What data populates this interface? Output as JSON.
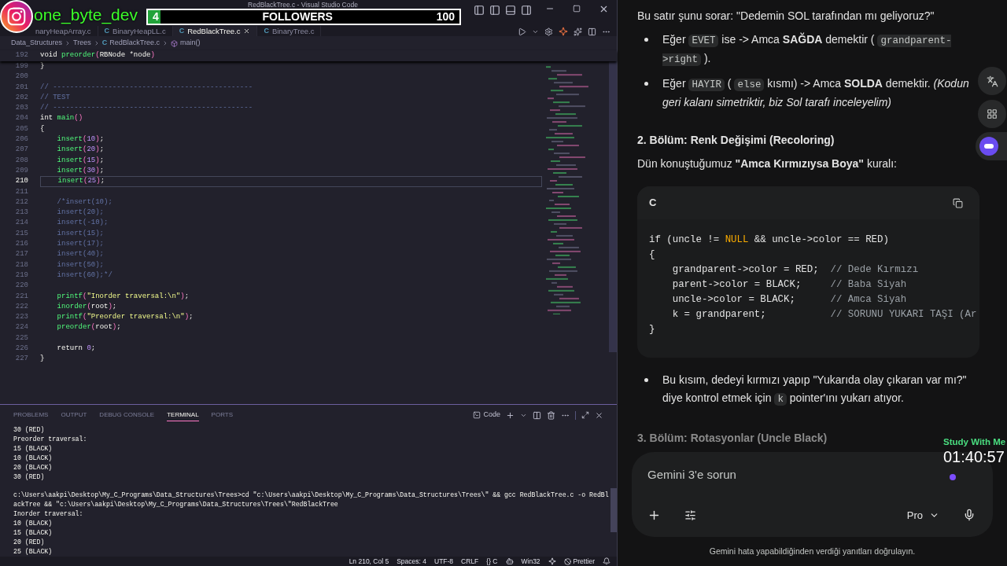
{
  "overlay": {
    "handle": "one_byte_dev",
    "followers": {
      "count": "4",
      "label": "FOLLOWERS",
      "goal": "100",
      "level": 0.04
    },
    "study_label": "Study With Me",
    "timer": "01:40:57"
  },
  "window": {
    "title": "RedBlackTree.c - Visual Studio Code"
  },
  "tabs": [
    {
      "label": "naryHeapArray.c",
      "selected": false
    },
    {
      "label": "BinaryHeapLL.c",
      "icon": "C",
      "selected": false
    },
    {
      "label": "RedBlackTree.c",
      "icon": "C",
      "selected": true
    },
    {
      "label": "BinaryTree.c",
      "icon": "C",
      "selected": false
    }
  ],
  "breadcrumb": [
    {
      "label": "Data_Structures"
    },
    {
      "label": "Trees"
    },
    {
      "label": "RedBlackTree.c",
      "icon": "C"
    },
    {
      "label": "main()"
    }
  ],
  "editor": {
    "sticky": {
      "num": "192",
      "text": "void preorder(RBNode *node)"
    },
    "lines": [
      {
        "num": "199",
        "current": false,
        "text": "}"
      },
      {
        "num": "200",
        "current": false
      },
      {
        "num": "201",
        "current": false,
        "text": "// -----------------------------------------------"
      },
      {
        "num": "202",
        "current": false,
        "text": "// TEST"
      },
      {
        "num": "203",
        "current": false,
        "text": "// -----------------------------------------------"
      },
      {
        "num": "204",
        "current": false,
        "text": "int main()"
      },
      {
        "num": "205",
        "current": false,
        "text": "{"
      },
      {
        "num": "206",
        "current": false,
        "text": "    insert(10);"
      },
      {
        "num": "207",
        "current": false,
        "text": "    insert(20);"
      },
      {
        "num": "208",
        "current": false,
        "text": "    insert(15);"
      },
      {
        "num": "209",
        "current": false,
        "text": "    insert(30);"
      },
      {
        "num": "210",
        "current": true,
        "text": "    insert(25);"
      },
      {
        "num": "211",
        "current": false
      },
      {
        "num": "212",
        "current": false,
        "text": "    /*insert(10);"
      },
      {
        "num": "213",
        "current": false,
        "text": "    insert(20);"
      },
      {
        "num": "214",
        "current": false,
        "text": "    insert(-10);"
      },
      {
        "num": "215",
        "current": false,
        "text": "    insert(15);"
      },
      {
        "num": "216",
        "current": false,
        "text": "    insert(17);"
      },
      {
        "num": "217",
        "current": false,
        "text": "    insert(40);"
      },
      {
        "num": "218",
        "current": false,
        "text": "    insert(50);"
      },
      {
        "num": "219",
        "current": false,
        "text": "    insert(60);*/"
      },
      {
        "num": "220",
        "current": false
      },
      {
        "num": "221",
        "current": false,
        "text": "    printf(\"Inorder traversal:\\n\");"
      },
      {
        "num": "222",
        "current": false,
        "text": "    inorder(root);"
      },
      {
        "num": "223",
        "current": false,
        "text": "    printf(\"Preorder traversal:\\n\");"
      },
      {
        "num": "224",
        "current": false,
        "text": "    preorder(root);"
      },
      {
        "num": "225",
        "current": false
      },
      {
        "num": "226",
        "current": false,
        "text": "    return 0;"
      },
      {
        "num": "227",
        "current": false,
        "text": "}"
      }
    ]
  },
  "panel": {
    "tabs": [
      {
        "label": "PROBLEMS",
        "selected": false
      },
      {
        "label": "OUTPUT",
        "selected": false
      },
      {
        "label": "DEBUG CONSOLE",
        "selected": false
      },
      {
        "label": "TERMINAL",
        "selected": true
      },
      {
        "label": "PORTS",
        "selected": false
      }
    ],
    "profile": "Code",
    "output": [
      {
        "lines": [
          "30 (RED)",
          "Preorder traversal:",
          "15 (BLACK)",
          "10 (BLACK)",
          "20 (BLACK)",
          "30 (RED)"
        ]
      },
      {
        "lines": [
          "c:\\Users\\aakpi\\Desktop\\My_C_Programs\\Data_Structures\\Trees>cd \"c:\\Users\\aakpi\\Desktop\\My_C_Programs\\Data_Structures\\Trees\\\" && gcc RedBlackTree.c -o RedBl",
          "ackTree && \"c:\\Users\\aakpi\\Desktop\\My_C_Programs\\Data_Structures\\Trees\\\"RedBlackTree",
          "Inorder traversal:",
          "10 (BLACK)",
          "15 (BLACK)",
          "20 (RED)",
          "25 (BLACK)"
        ]
      }
    ]
  },
  "status_bar": [
    "Ln 210, Col 5",
    "Spaces: 4",
    "UTF-8",
    "CRLF",
    "{} C",
    "Win32",
    "Prettier"
  ],
  "chat": {
    "blocks": [
      {
        "kind": "paragraph",
        "parts": [
          {
            "kind": "text",
            "text": "Bu satır şunu sorar: \"Dedemin SOL tarafından mı geliyoruz?\""
          }
        ]
      },
      {
        "kind": "bullet",
        "parts": [
          {
            "kind": "text",
            "text": "Eğer "
          },
          {
            "kind": "code",
            "text": "EVET"
          },
          {
            "kind": "text",
            "text": " ise -> Amca **SAĞDA** demektir ( "
          },
          {
            "kind": "code",
            "text": "grandparent->right"
          },
          {
            "kind": "text",
            "text": " )."
          }
        ]
      },
      {
        "kind": "bullet",
        "parts": [
          {
            "kind": "text",
            "text": "Eğer "
          },
          {
            "kind": "code",
            "text": "HAYIR"
          },
          {
            "kind": "text",
            "text": " ( "
          },
          {
            "kind": "code",
            "text": "else"
          },
          {
            "kind": "text",
            "text": " kısmı) -> Amca **SOLDA** demektir. *(Kodun geri kalanı simetriktir, biz Sol tarafı inceleyelim)*"
          }
        ]
      },
      {
        "kind": "heading",
        "faded": false,
        "parts": [
          {
            "kind": "text",
            "text": "2. Bölüm: Renk Değişimi (Recoloring)"
          }
        ]
      },
      {
        "kind": "paragraph",
        "parts": [
          {
            "kind": "text",
            "text": "Dün konuştuğumuz **\"Amca Kırmızıysa Boya\"** kuralı:"
          }
        ]
      },
      {
        "kind": "code",
        "language": "C",
        "lines": [
          "if (uncle != NULL && uncle->color == RED)",
          "{",
          "    grandparent->color = RED;  // Dede Kırmızı",
          "    parent->color = BLACK;     // Baba Siyah",
          "    uncle->color = BLACK;      // Amca Siyah",
          "    k = grandparent;           // SORUNU YUKARI TAŞI (Ar",
          "}"
        ]
      },
      {
        "kind": "bullet",
        "parts": [
          {
            "kind": "text",
            "text": "Bu kısım, dedeyi kırmızı yapıp \"Yukarıda olay çıkaran var mı?\" diye kontrol etmek için "
          },
          {
            "kind": "code",
            "text": "k"
          },
          {
            "kind": "text",
            "text": " pointer'ını yukarı atıyor."
          }
        ]
      },
      {
        "kind": "heading",
        "faded": true,
        "parts": [
          {
            "kind": "text",
            "text": "3. Bölüm: Rotasyonlar (Uncle Black)"
          }
        ]
      }
    ],
    "input": {
      "placeholder": "Gemini 3'e sorun",
      "model": "Pro"
    },
    "disclaimer": "Gemini hata yapabildiğinden verdiği yanıtları doğrulayın."
  }
}
